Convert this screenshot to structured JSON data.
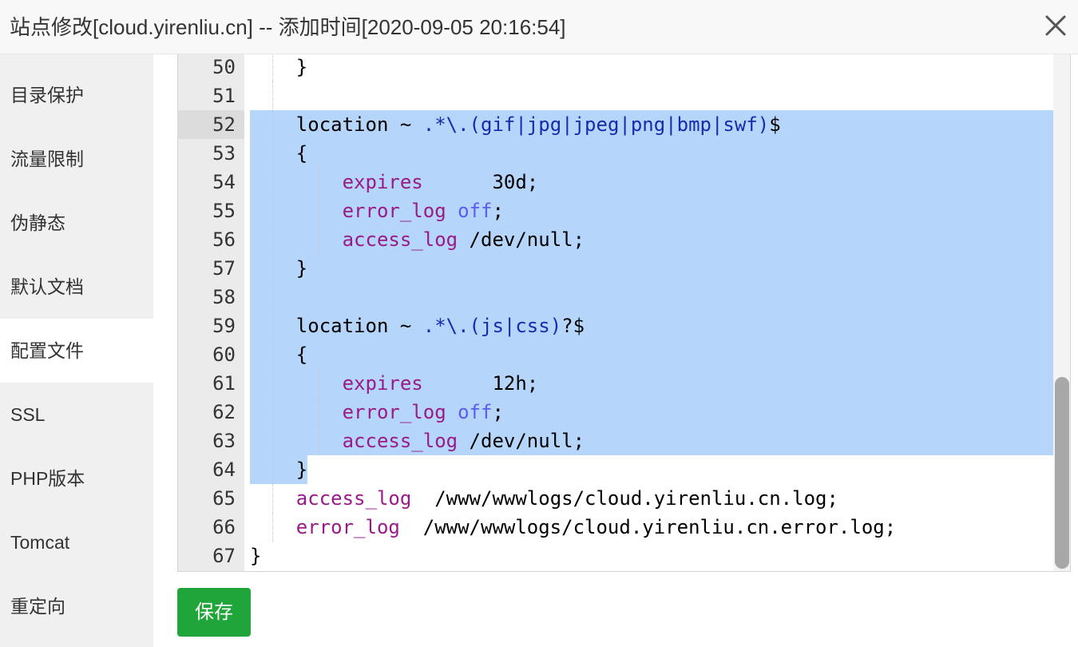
{
  "dialog": {
    "title": "站点修改[cloud.yirenliu.cn] -- 添加时间[2020-09-05 20:16:54]"
  },
  "sidebar": {
    "items": [
      "目录保护",
      "流量限制",
      "伪静态",
      "默认文档",
      "配置文件",
      "SSL",
      "PHP版本",
      "Tomcat",
      "重定向"
    ],
    "active_index": 4
  },
  "editor": {
    "lines": [
      {
        "num": "50",
        "indent": 1,
        "tokens": [
          {
            "t": "}"
          }
        ]
      },
      {
        "num": "51",
        "indent": 1,
        "tokens": []
      },
      {
        "num": "52",
        "indent": 1,
        "tokens": [
          {
            "t": "location"
          },
          {
            "t": " ~ "
          },
          {
            "t": ".*\\.(gif|jpg|jpeg|png|bmp|swf)",
            "c": "rx"
          },
          {
            "t": "$"
          }
        ]
      },
      {
        "num": "53",
        "indent": 1,
        "tokens": [
          {
            "t": "{"
          }
        ]
      },
      {
        "num": "54",
        "indent": 2,
        "tokens": [
          {
            "t": "expires",
            "c": "kw"
          },
          {
            "t": "      30d;"
          }
        ]
      },
      {
        "num": "55",
        "indent": 2,
        "tokens": [
          {
            "t": "error_log",
            "c": "kw"
          },
          {
            "t": " "
          },
          {
            "t": "off",
            "c": "on"
          },
          {
            "t": ";"
          }
        ]
      },
      {
        "num": "56",
        "indent": 2,
        "tokens": [
          {
            "t": "access_log",
            "c": "kw"
          },
          {
            "t": " /dev/null;"
          }
        ]
      },
      {
        "num": "57",
        "indent": 1,
        "tokens": [
          {
            "t": "}"
          }
        ]
      },
      {
        "num": "58",
        "indent": 1,
        "tokens": []
      },
      {
        "num": "59",
        "indent": 1,
        "tokens": [
          {
            "t": "location"
          },
          {
            "t": " ~ "
          },
          {
            "t": ".*\\.(js|css)",
            "c": "rx"
          },
          {
            "t": "?$"
          }
        ]
      },
      {
        "num": "60",
        "indent": 1,
        "tokens": [
          {
            "t": "{"
          }
        ]
      },
      {
        "num": "61",
        "indent": 2,
        "tokens": [
          {
            "t": "expires",
            "c": "kw"
          },
          {
            "t": "      12h;"
          }
        ]
      },
      {
        "num": "62",
        "indent": 2,
        "tokens": [
          {
            "t": "error_log",
            "c": "kw"
          },
          {
            "t": " "
          },
          {
            "t": "off",
            "c": "on"
          },
          {
            "t": ";"
          }
        ]
      },
      {
        "num": "63",
        "indent": 2,
        "tokens": [
          {
            "t": "access_log",
            "c": "kw"
          },
          {
            "t": " /dev/null;"
          }
        ]
      },
      {
        "num": "64",
        "indent": 1,
        "tokens": [
          {
            "t": "}"
          }
        ]
      },
      {
        "num": "65",
        "indent": 1,
        "tokens": [
          {
            "t": "access_log",
            "c": "kw"
          },
          {
            "t": "  /www/wwwlogs/cloud.yirenliu.cn.log;"
          }
        ]
      },
      {
        "num": "66",
        "indent": 1,
        "tokens": [
          {
            "t": "error_log",
            "c": "kw"
          },
          {
            "t": "  /www/wwwlogs/cloud.yirenliu.cn.error.log;"
          }
        ]
      },
      {
        "num": "67",
        "indent": 0,
        "tokens": [
          {
            "t": "}"
          }
        ]
      }
    ],
    "current_line": "52",
    "selection": {
      "from_line": "52",
      "to_line": "64"
    }
  },
  "buttons": {
    "save_label": "保存"
  },
  "colors": {
    "save_button": "#20a53a",
    "selection": "#b5d5fb",
    "keyword": "#9a1a8a",
    "regex": "#1a2ab0",
    "value_off": "#5c5cf0"
  },
  "icons": {
    "close": "close-icon"
  }
}
